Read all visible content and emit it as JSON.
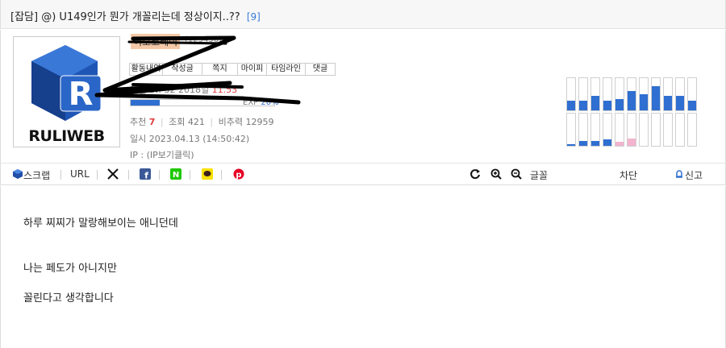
{
  "post": {
    "category": "[잡담]",
    "title": "@) U149인가 뭔가 개꼴리는데 정상이지..??",
    "comment_count": "[9]"
  },
  "author": {
    "logo_text": "RULIWEB",
    "nickname": "이모코레이",
    "nickname_id": "(123456)",
    "tabs": [
      "활동내역",
      "작성글",
      "쪽지",
      "마이피",
      "타임라인",
      "댓글"
    ],
    "level_label": "레벨",
    "level_value": "Lv. 32",
    "level_detail": "2018일",
    "level_extra": "11.53",
    "exp_label": "EXP",
    "exp_value": "20%",
    "exp_fraction": 0.2
  },
  "stats": {
    "recommend_label": "추천",
    "recommend_value": "7",
    "views_label": "조회",
    "views_value": "421",
    "influence_label": "비추력",
    "influence_value": "12959",
    "date_label": "일시",
    "date_value": "2023.04.13 (14:50:42)",
    "ip_label": "IP :",
    "ip_value": "(IP보기클릭)"
  },
  "graph": {
    "top_levels": [
      0.3,
      0.3,
      0.45,
      0.3,
      0.35,
      0.6,
      0.5,
      0.75,
      0.45,
      0.45,
      0.3
    ],
    "bottom_levels": [
      0.05,
      0.15,
      0.15,
      0.2,
      0.12,
      0.22,
      0,
      0,
      0,
      0,
      0
    ],
    "bottom_colors": [
      "blue",
      "blue",
      "blue",
      "blue",
      "pink",
      "pink",
      "blue",
      "blue",
      "blue",
      "blue",
      "blue"
    ],
    "blue": "#2f6fd1",
    "pink": "#f3b4cf"
  },
  "toolbar": {
    "scrap_label": "스크랩",
    "url_label": "URL",
    "font_label": "글꼴",
    "block_label": "차단",
    "report_label": "신고"
  },
  "body": {
    "line1": "하루 찌찌가 말랑해보이는 애니던데",
    "line2": "나는 페도가 아니지만",
    "line3": "꼴린다고 생각합니다"
  }
}
